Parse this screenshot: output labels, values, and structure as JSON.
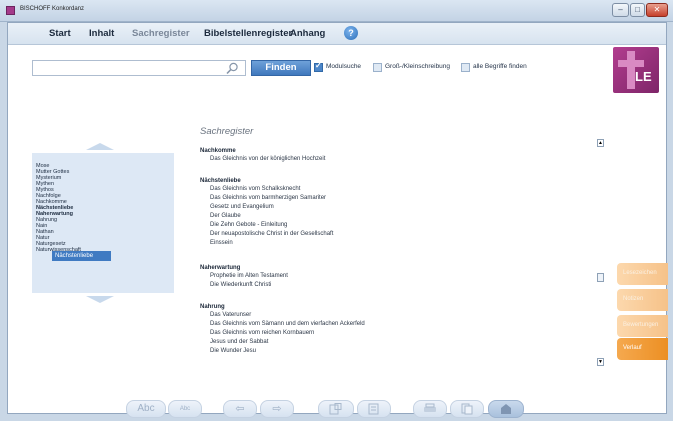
{
  "window": {
    "title": "BISCHOFF Konkordanz",
    "buttons": {
      "minimize": "–",
      "maximize": "□",
      "close": "✕"
    }
  },
  "menu": {
    "start": "Start",
    "inhalt": "Inhalt",
    "sachregister": "Sachregister",
    "bibelstellen": "Bibelstellenregister",
    "anhang": "Anhang",
    "help": "?"
  },
  "logo": {
    "text": "LE"
  },
  "search": {
    "query": "",
    "find_label": "Finden",
    "options": [
      {
        "label": "Modulsuche",
        "checked": true
      },
      {
        "label": "Groß-/Kleinschreibung",
        "checked": false
      },
      {
        "label": "alle Begriffe finden",
        "checked": false
      }
    ]
  },
  "list": {
    "items": [
      "Mose",
      "Mutter Gottes",
      "Mysterium",
      "Mythen",
      "Mythos",
      "Nachfolge",
      "Nachkomme",
      "Nächstenliebe",
      "Naherwartung",
      "Nahrung",
      "Nain",
      "Nathan",
      "Natur",
      "Naturgesetz",
      "Naturwissenschaft"
    ],
    "selected": "Nächstenliebe",
    "tooltip": "Nächstenliebe"
  },
  "register": {
    "title": "Sachregister",
    "sections": [
      {
        "head": "Nachkomme",
        "entries": [
          "Das Gleichnis von der königlichen Hochzeit"
        ]
      },
      {
        "head": "Nächstenliebe",
        "entries": [
          "Das Gleichnis vom Schalksknecht",
          "Das Gleichnis vom barmherzigen Samariter",
          "Gesetz und Evangelium",
          "Der Glaube",
          "Die Zehn Gebote - Einleitung",
          "Der neuapostolische Christ in der Gesellschaft",
          "Einssein"
        ]
      },
      {
        "head": "Naherwartung",
        "entries": [
          "Prophetie im Alten Testament",
          "Die Wiederkunft Christi"
        ]
      },
      {
        "head": "Nahrung",
        "entries": [
          "Das Vaterunser",
          "Das Gleichnis vom Sämann und dem vierfachen Ackerfeld",
          "Das Gleichnis vom reichen Kornbauern",
          "Jesus und der Sabbat",
          "Die Wunder Jesu"
        ]
      }
    ]
  },
  "side_tabs": [
    {
      "label": "Lesezeichen",
      "active": false
    },
    {
      "label": "Notizen",
      "active": false
    },
    {
      "label": "Bewertungen",
      "active": false
    },
    {
      "label": "Verlauf",
      "active": true
    }
  ],
  "toolbar": {
    "abc_large": "Abc",
    "abc_small": "Abc"
  },
  "colors": {
    "accent_blue": "#4c86c9",
    "logo_magenta": "#b23d8f",
    "tab_orange": "#ec8f23"
  }
}
